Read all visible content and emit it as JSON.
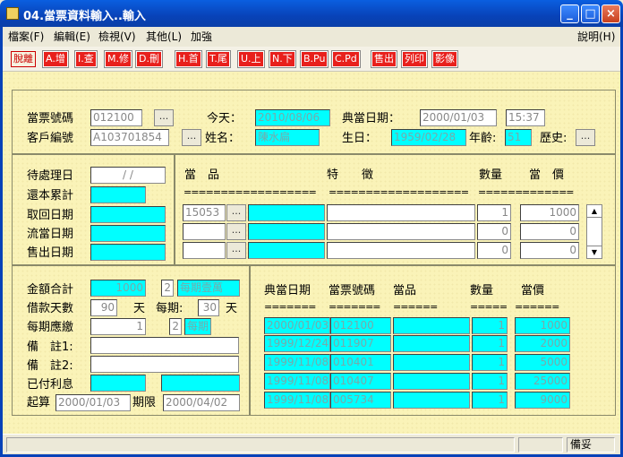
{
  "window": {
    "title": "04.當票資料輸入..輸入"
  },
  "menu": [
    "檔案(F)",
    "編輯(E)",
    "檢視(V)",
    "其他(L)",
    "加強"
  ],
  "menu_help": "說明(H)",
  "toolbar": [
    "脫離",
    "A.增",
    "I.查",
    "M.修",
    "D.刪",
    "H.首",
    "T.尾",
    "U.上",
    "N.下",
    "B.Pu",
    "C.Pd",
    "售出",
    "列印",
    "影像"
  ],
  "top": {
    "ticket_no_label": "當票號碼",
    "ticket_no": "012100",
    "customer_no_label": "客戶編號",
    "customer_no": "A103701854",
    "today_label": "今天：",
    "today": "2010/08/06",
    "name_label": "姓名：",
    "name": "陳水扁",
    "pawn_date_label": "典當日期：",
    "pawn_date": "2000/01/03",
    "pawn_time": "15:37",
    "birthday_label": "生日：",
    "birthday": "1959/02/28",
    "age_label": "年齡:",
    "age": "51",
    "history_label": "歷史:",
    "ellipsis": "..."
  },
  "mid": {
    "labels": [
      "待處理日",
      "還本累計",
      "取回日期",
      "流當日期",
      "售出日期"
    ],
    "pending_date": "/ /",
    "headers": {
      "item": "當　品",
      "feature": "特　　徵",
      "qty": "數量",
      "price": "當　價"
    },
    "sep_item": "==================",
    "sep_feature": "===================",
    "sep_qty": "======",
    "sep_price": "=======",
    "rows": [
      {
        "code": "15053",
        "qty": "1",
        "price": "1000"
      },
      {
        "code": "",
        "qty": "0",
        "price": "0"
      },
      {
        "code": "",
        "qty": "0",
        "price": "0"
      }
    ]
  },
  "bottom": {
    "total_label": "金額合計",
    "total": "1000",
    "total_code": "2",
    "total_desc": "每期壹萬",
    "loan_days_label": "借款天數",
    "loan_days": "90",
    "days_unit": "天",
    "per_period_label": "每期:",
    "per_period": "30",
    "per_period_unit": "天",
    "renew_label": "每期應繳",
    "renew_amount": "1",
    "renew_code": "2",
    "renew_desc": "每期",
    "note1_label": "備　註1:",
    "note2_label": "備　註2:",
    "paid_interest_label": "已付利息",
    "start_label": "起算",
    "start_date": "2000/01/03",
    "limit_label": "期限",
    "limit_date": "2000/04/02"
  },
  "history": {
    "headers": [
      "典當日期",
      "當票號碼",
      "當品",
      "數量",
      "當價"
    ],
    "sep": [
      "=======",
      "=======",
      "======",
      "=====",
      "======"
    ],
    "rows": [
      {
        "date": "2000/01/03",
        "ticket": "012100",
        "qty": "1",
        "price": "1000"
      },
      {
        "date": "1999/12/24",
        "ticket": "011907",
        "qty": "1",
        "price": "2000"
      },
      {
        "date": "1999/11/08",
        "ticket": "010401",
        "qty": "1",
        "price": "5000"
      },
      {
        "date": "1999/11/08",
        "ticket": "010407",
        "qty": "1",
        "price": "25000"
      },
      {
        "date": "1999/11/08",
        "ticket": "005734",
        "qty": "1",
        "price": "9000"
      }
    ]
  },
  "status": {
    "field": "備妥"
  }
}
